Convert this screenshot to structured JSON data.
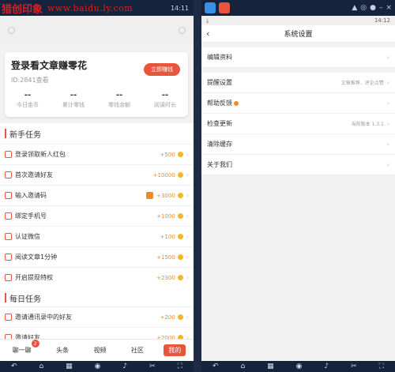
{
  "watermark": {
    "brand": "猎创印象",
    "url": "www.baidu.ly.com"
  },
  "left": {
    "status_time": "14:11",
    "card": {
      "title": "登录看文章赚零花",
      "subtitle": "ID:2841查看",
      "button": "立即赚钱",
      "stats": [
        {
          "value": "--",
          "label": "今日金币"
        },
        {
          "value": "--",
          "label": "累计零钱"
        },
        {
          "value": "--",
          "label": "零钱余额"
        },
        {
          "value": "--",
          "label": "阅读时长"
        }
      ]
    },
    "section1": "新手任务",
    "tasks": [
      {
        "label": "登录领取新人红包",
        "reward": "+500",
        "tag": false
      },
      {
        "label": "首次邀请好友",
        "reward": "+10000",
        "tag": false
      },
      {
        "label": "输入邀请码",
        "reward": "+3000",
        "tag": true
      },
      {
        "label": "绑定手机号",
        "reward": "+1000",
        "tag": false
      },
      {
        "label": "认证微信",
        "reward": "+100",
        "tag": false
      },
      {
        "label": "阅读文章1分钟",
        "reward": "+1500",
        "tag": false
      },
      {
        "label": "开启提现特权",
        "reward": "+2300",
        "tag": false
      }
    ],
    "section2": "每日任务",
    "daily": [
      {
        "label": "邀请通讯录中的好友",
        "reward": "+200"
      },
      {
        "label": "邀请好友",
        "reward": "+2000"
      }
    ],
    "tabs": [
      {
        "label": "聊一聊",
        "badge": "2"
      },
      {
        "label": "头条"
      },
      {
        "label": "视频"
      },
      {
        "label": "社区"
      },
      {
        "label": "我的"
      }
    ]
  },
  "right": {
    "status_time": "14:12",
    "title": "系统设置",
    "back": "‹",
    "rows": [
      {
        "label": "编辑资料",
        "value": ""
      },
      {
        "label": "提醒设置",
        "value": "文章推荐、评论点赞"
      },
      {
        "label": "帮助反馈",
        "value": "",
        "dot": true
      },
      {
        "label": "检查更新",
        "value": "当前版本 1.3.1"
      },
      {
        "label": "清除缓存",
        "value": ""
      },
      {
        "label": "关于我们",
        "value": ""
      }
    ]
  },
  "colors": {
    "accent": "#e9553c",
    "coin": "#f5b623",
    "reward": "#f08a28",
    "navbar": "#15233c"
  }
}
